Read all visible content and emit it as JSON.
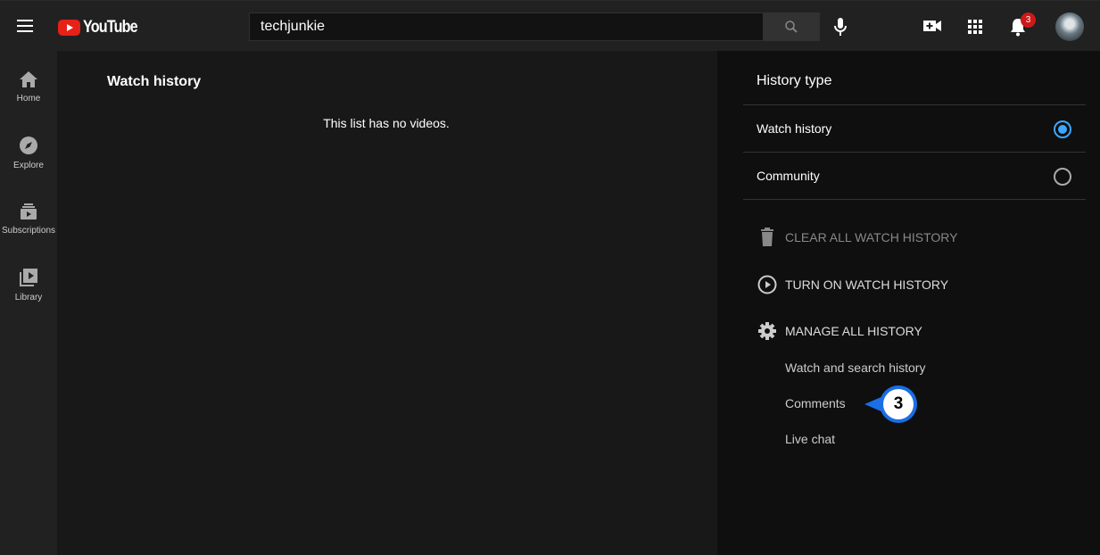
{
  "header": {
    "logo": "YouTube",
    "search_value": "techjunkie",
    "notification_count": "3"
  },
  "sidebar": {
    "items": [
      {
        "label": "Home",
        "icon": "home-icon"
      },
      {
        "label": "Explore",
        "icon": "compass-icon"
      },
      {
        "label": "Subscriptions",
        "icon": "subscriptions-icon"
      },
      {
        "label": "Library",
        "icon": "library-icon"
      }
    ]
  },
  "main": {
    "title": "Watch history",
    "empty_message": "This list has no videos."
  },
  "panel": {
    "title": "History type",
    "options": [
      {
        "label": "Watch history",
        "selected": true
      },
      {
        "label": "Community",
        "selected": false
      }
    ],
    "actions": [
      {
        "label": "CLEAR ALL WATCH HISTORY"
      },
      {
        "label": "TURN ON WATCH HISTORY"
      },
      {
        "label": "MANAGE ALL HISTORY"
      }
    ],
    "links": [
      "Watch and search history",
      "Comments",
      "Live chat"
    ]
  },
  "annotation": {
    "step": "3"
  },
  "colors": {
    "accent": "#3ea6ff",
    "brand": "#e62117",
    "callout": "#1a6ee6"
  }
}
